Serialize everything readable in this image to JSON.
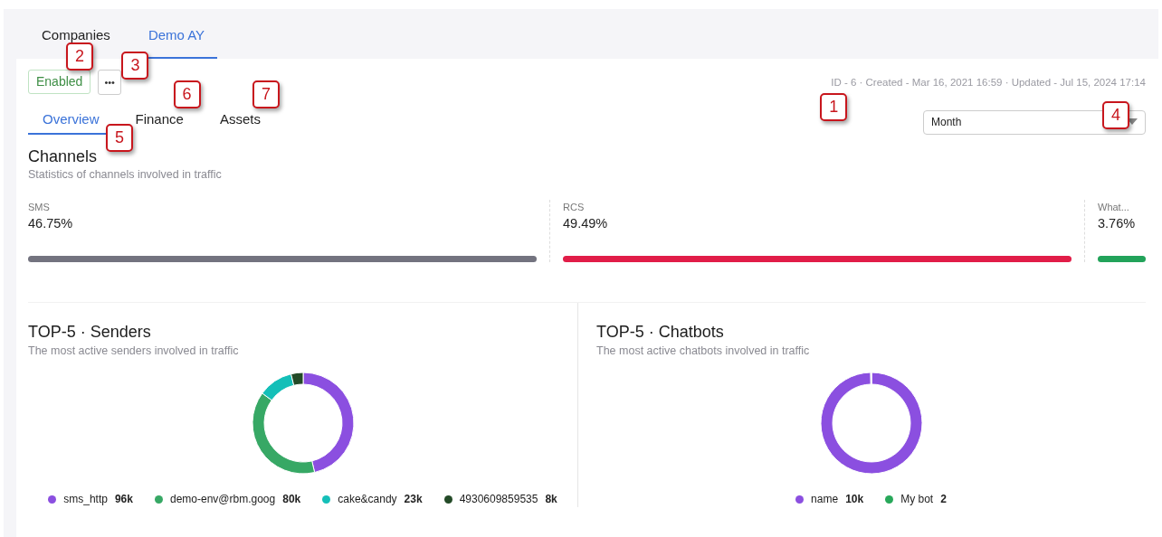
{
  "breadcrumbs": [
    {
      "label": "Companies",
      "selected": false
    },
    {
      "label": "Demo AY",
      "selected": true
    }
  ],
  "status_button": {
    "label": "Enabled",
    "callout": "2"
  },
  "more_button": {
    "label": "•••",
    "callout": "3"
  },
  "meta": {
    "text": "ID - 6 · Created - Mar 16, 2021 16:59 · Updated - Jul 15, 2024 17:14",
    "callout": "1"
  },
  "tabs": [
    {
      "label": "Overview",
      "selected": true,
      "callout": "5"
    },
    {
      "label": "Finance",
      "selected": false,
      "callout": "6"
    },
    {
      "label": "Assets",
      "selected": false,
      "callout": "7"
    }
  ],
  "period_select": {
    "value": "Month",
    "callout": "4"
  },
  "channels_section": {
    "title": "Channels",
    "subtitle": "Statistics of channels involved in traffic",
    "channels": [
      {
        "name": "SMS",
        "share": "46.75%",
        "color": "#73737f"
      },
      {
        "name": "RCS",
        "share": "49.49%",
        "color": "#e11d48"
      },
      {
        "name": "What...",
        "share": "3.76%",
        "color": "#22a35a"
      }
    ]
  },
  "panels": [
    {
      "title": "TOP-5 · Senders",
      "subtitle": "The most active senders involved in traffic",
      "chart_data": {
        "type": "donut",
        "categories": [
          "sms_http",
          "demo-env@rbm.goog",
          "cake&candy",
          "4930609859535"
        ],
        "series": [
          {
            "values": [
              46.38,
              38.65,
              11.11,
              3.86
            ]
          }
        ],
        "value_labels": [
          "96k",
          "80k",
          "23k",
          "8k"
        ]
      },
      "legend": [
        {
          "color": "#8b4fe0"
        },
        {
          "color": "#37a865"
        },
        {
          "color": "#14bfb8"
        },
        {
          "color": "#234a27"
        }
      ]
    },
    {
      "title": "TOP-5 · Chatbots",
      "subtitle": "The most active chatbots involved in traffic",
      "chart_data": {
        "type": "donut",
        "categories": [
          "name",
          "My bot"
        ],
        "series": [
          {
            "values": [
              99.98,
              0.02
            ]
          }
        ],
        "value_labels": [
          "10k",
          "2"
        ]
      },
      "legend": [
        {
          "color": "#8b4fe0"
        },
        {
          "color": "#28a85a"
        }
      ]
    }
  ]
}
